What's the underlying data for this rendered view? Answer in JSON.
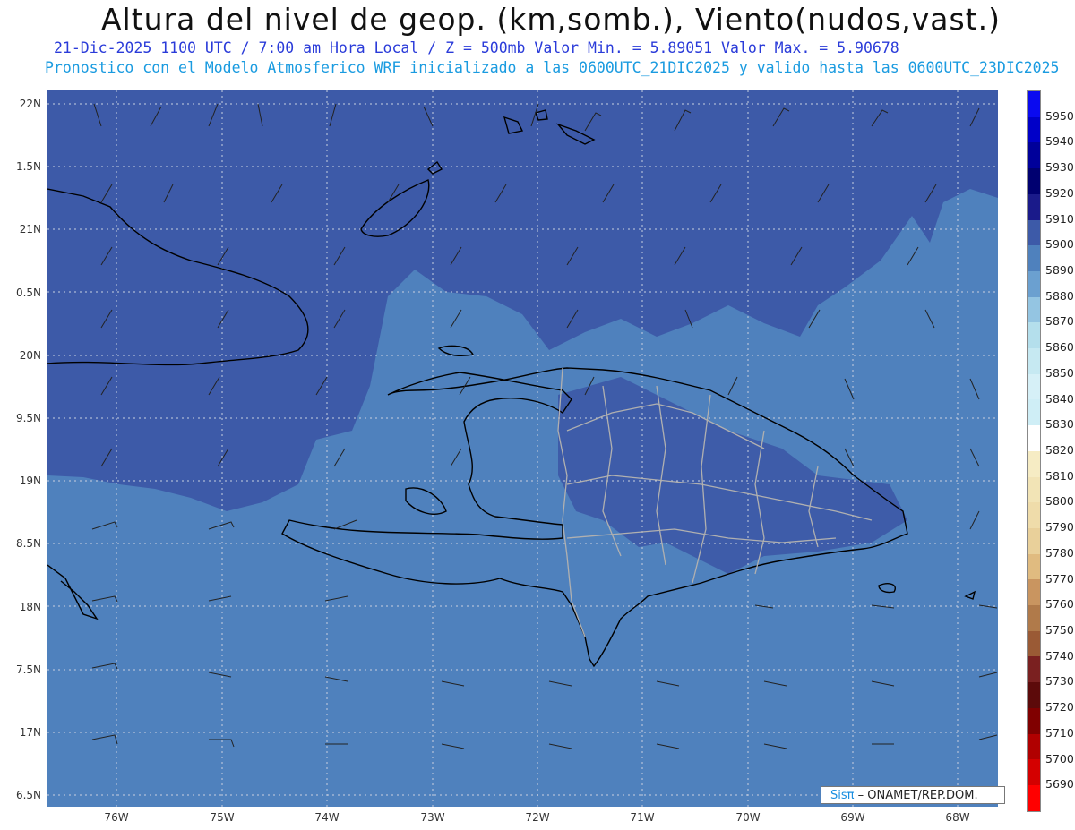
{
  "header": {
    "title": "Altura del nivel de geop. (km,somb.), Viento(nudos,vast.)",
    "subtitle_line1": "21-Dic-2025   1100 UTC / 7:00 am Hora Local / Z = 500mb     Valor Min. = 5.89051  Valor Max. = 5.90678",
    "subtitle_line2": "Pronostico con el Modelo Atmosferico WRF inicializado a las 0600UTC_21DIC2025 y valido hasta las  0600UTC_23DIC2025"
  },
  "map": {
    "lat_labels": [
      "22N",
      "1.5N",
      "21N",
      "0.5N",
      "20N",
      "9.5N",
      "19N",
      "8.5N",
      "18N",
      "7.5N",
      "17N",
      "6.5N"
    ],
    "lon_labels": [
      "76W",
      "75W",
      "74W",
      "73W",
      "72W",
      "71W",
      "70W",
      "69W",
      "68W"
    ],
    "colors": {
      "shade_5900": "#3d5aa8",
      "shade_5890": "#4f81bd",
      "grid": "#c8d0e0",
      "coast": "#000000",
      "borders": "#b0b0b0"
    }
  },
  "colorbar": {
    "labels": [
      "5950",
      "5940",
      "5930",
      "5920",
      "5910",
      "5900",
      "5890",
      "5880",
      "5870",
      "5860",
      "5850",
      "5840",
      "5830",
      "5820",
      "5810",
      "5800",
      "5790",
      "5780",
      "5770",
      "5760",
      "5750",
      "5740",
      "5730",
      "5720",
      "5710",
      "5700",
      "5690"
    ],
    "colors": [
      "#0a0af0",
      "#0000c8",
      "#00009a",
      "#000070",
      "#1a1a8a",
      "#3d5aa8",
      "#4f81bd",
      "#6ba0d0",
      "#94c5e2",
      "#b4dfec",
      "#c6e9f2",
      "#d6f0f7",
      "#cfeef6",
      "#ffffff",
      "#f6ecc4",
      "#f2e4b6",
      "#efdcaa",
      "#e9d09a",
      "#e0bb80",
      "#c99560",
      "#b07a4a",
      "#9a5a35",
      "#7a2020",
      "#5c0a0a",
      "#800000",
      "#b00000",
      "#d40000",
      "#ff0000"
    ]
  },
  "credit": {
    "sis": "Sisπ",
    "text": " – ONAMET/REP.DOM."
  }
}
